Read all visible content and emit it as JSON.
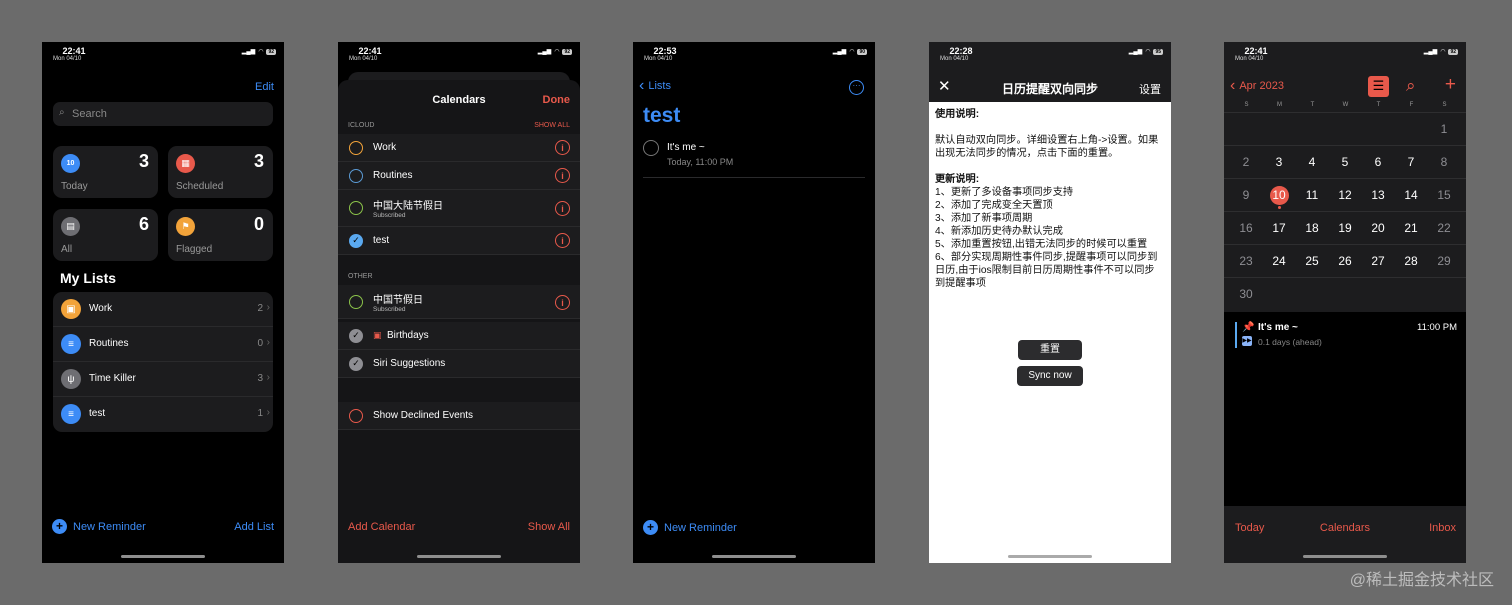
{
  "p1": {
    "time": "22:41",
    "date": "Mon 04/10",
    "battery": "92",
    "edit": "Edit",
    "search": "Search",
    "cards": {
      "today": {
        "label": "Today",
        "count": "3",
        "day": "10"
      },
      "scheduled": {
        "label": "Scheduled",
        "count": "3"
      },
      "all": {
        "label": "All",
        "count": "6"
      },
      "flagged": {
        "label": "Flagged",
        "count": "0"
      }
    },
    "my_lists": "My Lists",
    "lists": [
      {
        "label": "Work",
        "count": "2"
      },
      {
        "label": "Routines",
        "count": "0"
      },
      {
        "label": "Time Killer",
        "count": "3"
      },
      {
        "label": "test",
        "count": "1"
      }
    ],
    "new_reminder": "New Reminder",
    "add_list": "Add List"
  },
  "p2": {
    "time": "22:41",
    "date": "Mon 04/10",
    "battery": "92",
    "title": "Calendars",
    "done": "Done",
    "icloud": "ICLOUD",
    "show_all_top": "SHOW ALL",
    "icloud_items": [
      {
        "label": "Work",
        "sub": ""
      },
      {
        "label": "Routines",
        "sub": ""
      },
      {
        "label": "中国大陆节假日",
        "sub": "Subscribed"
      },
      {
        "label": "test",
        "sub": ""
      }
    ],
    "other": "OTHER",
    "other_items": [
      {
        "label": "中国节假日",
        "sub": "Subscribed"
      },
      {
        "label": "Birthdays",
        "sub": ""
      },
      {
        "label": "Siri Suggestions",
        "sub": ""
      }
    ],
    "declined": "Show Declined Events",
    "add_calendar": "Add Calendar",
    "show_all": "Show All"
  },
  "p3": {
    "time": "22:53",
    "date": "Mon 04/10",
    "battery": "90",
    "back": "Lists",
    "title": "test",
    "item": "It's me ~",
    "item_time": "Today, 11:00 PM",
    "new_reminder": "New Reminder"
  },
  "p4": {
    "time": "22:28",
    "date": "Mon 04/10",
    "battery": "95",
    "title": "日历提醒双向同步",
    "settings": "设置",
    "usage_title": "使用说明:",
    "usage_text": "默认自动双向同步。详细设置右上角->设置。如果出现无法同步的情况，点击下面的重置。",
    "update_title": "更新说明:",
    "updates": [
      "1、更新了多设备事项同步支持",
      "2、添加了完成变全天置顶",
      "3、添加了新事项周期",
      "4、新添加历史待办默认完成",
      "5、添加重置按钮,出错无法同步的时候可以重置",
      "6、部分实现周期性事件同步,提醒事项可以同步到日历,由于ios限制目前日历周期性事件不可以同步到提醒事项"
    ],
    "reset": "重置",
    "sync": "Sync now"
  },
  "p5": {
    "time": "22:41",
    "date": "Mon 04/10",
    "battery": "92",
    "month": "Apr 2023",
    "weekdays": [
      "S",
      "M",
      "T",
      "W",
      "T",
      "F",
      "S"
    ],
    "weeks": [
      [
        "",
        "",
        "",
        "",
        "",
        "",
        "1"
      ],
      [
        "2",
        "3",
        "4",
        "5",
        "6",
        "7",
        "8"
      ],
      [
        "9",
        "10",
        "11",
        "12",
        "13",
        "14",
        "15"
      ],
      [
        "16",
        "17",
        "18",
        "19",
        "20",
        "21",
        "22"
      ],
      [
        "23",
        "24",
        "25",
        "26",
        "27",
        "28",
        "29"
      ],
      [
        "30",
        "",
        "",
        "",
        "",
        "",
        ""
      ]
    ],
    "event_title": "It's me ~",
    "event_time": "11:00 PM",
    "event_sub": "0.1 days (ahead)",
    "tab_today": "Today",
    "tab_calendars": "Calendars",
    "tab_inbox": "Inbox"
  },
  "watermark": "@稀土掘金技术社区",
  "colors": {
    "blue": "#3d8cf6",
    "red": "#e8594b",
    "bg": "#6b6b6b"
  }
}
